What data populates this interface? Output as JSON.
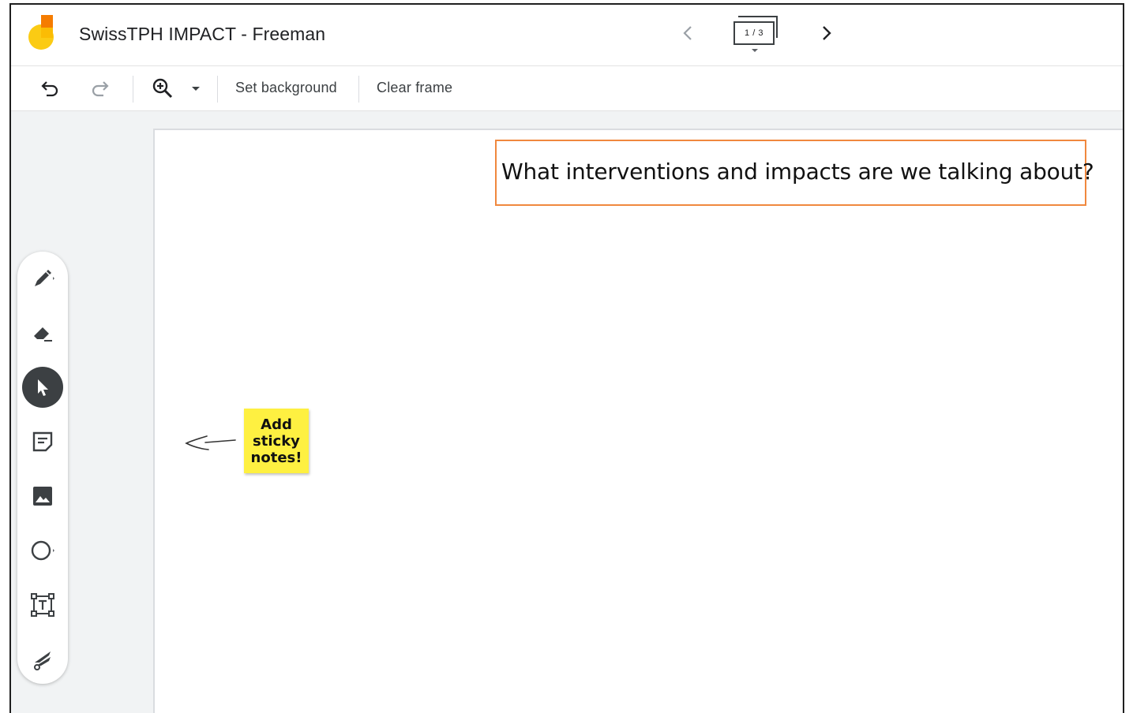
{
  "app": {
    "title": "SwissTPH IMPACT - Freeman",
    "frame_counter": "1 / 3"
  },
  "toolbar": {
    "set_background_label": "Set background",
    "clear_frame_label": "Clear frame"
  },
  "sidebar": {
    "tools": [
      "pen-icon",
      "eraser-icon",
      "select-icon",
      "sticky-note-icon",
      "image-icon",
      "circle-icon",
      "text-box-icon",
      "laser-icon"
    ],
    "active_tool": "select-icon"
  },
  "canvas": {
    "title_text": "What interventions and impacts are we talking about?",
    "sticky_note_text": "Add\nsticky\nnotes!",
    "colors": {
      "title_border": "#f0883e",
      "sticky_fill": "#fef041"
    }
  }
}
